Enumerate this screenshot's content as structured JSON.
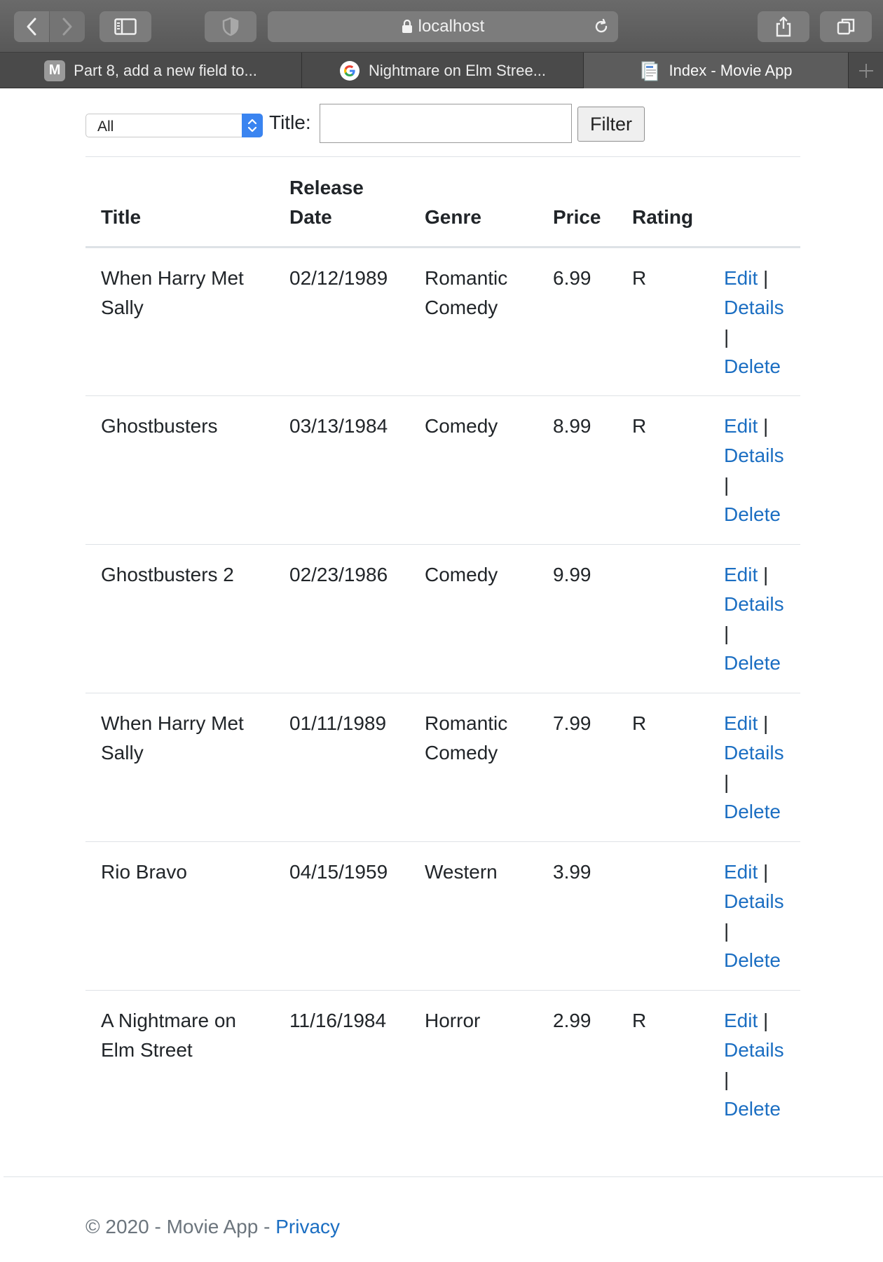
{
  "browser": {
    "url": "localhost",
    "tabs": [
      {
        "label": "Part 8, add a new field to...",
        "favicon": "M",
        "icon": "m-favicon-icon"
      },
      {
        "label": "Nightmare on Elm Stree...",
        "icon": "google-g-icon"
      },
      {
        "label": "Index - Movie App",
        "icon": "document-icon",
        "active": true
      }
    ]
  },
  "filter": {
    "genre_selected": "All",
    "title_label": "Title:",
    "title_value": "",
    "button_label": "Filter"
  },
  "table": {
    "headers": {
      "title": "Title",
      "release_date_line1": "Release",
      "release_date_line2": "Date",
      "genre": "Genre",
      "price": "Price",
      "rating": "Rating"
    },
    "rows": [
      {
        "title": "When Harry Met Sally",
        "release_date": "02/12/1989",
        "genre": "Romantic Comedy",
        "price": "6.99",
        "rating": "R"
      },
      {
        "title": "Ghostbusters",
        "release_date": "03/13/1984",
        "genre": "Comedy",
        "price": "8.99",
        "rating": "R"
      },
      {
        "title": "Ghostbusters 2",
        "release_date": "02/23/1986",
        "genre": "Comedy",
        "price": "9.99",
        "rating": ""
      },
      {
        "title": "When Harry Met Sally",
        "release_date": "01/11/1989",
        "genre": "Romantic Comedy",
        "price": "7.99",
        "rating": "R"
      },
      {
        "title": "Rio Bravo",
        "release_date": "04/15/1959",
        "genre": "Western",
        "price": "3.99",
        "rating": ""
      },
      {
        "title": "A Nightmare on Elm Street",
        "release_date": "11/16/1984",
        "genre": "Horror",
        "price": "2.99",
        "rating": "R"
      }
    ],
    "actions": {
      "edit": "Edit",
      "details": "Details",
      "delete": "Delete",
      "separator": "|"
    }
  },
  "footer": {
    "text": "© 2020 - Movie App - ",
    "privacy_link": "Privacy"
  },
  "colors": {
    "link": "#1b6ec2",
    "text": "#212529",
    "muted": "#6c757d",
    "select_accent": "#3a84f0"
  }
}
